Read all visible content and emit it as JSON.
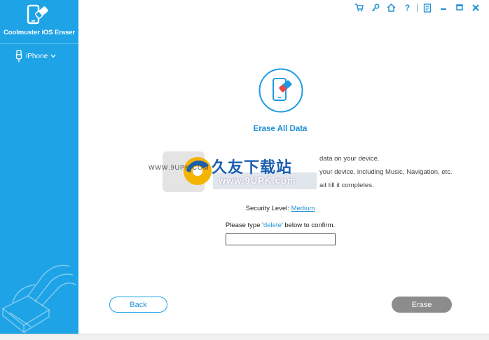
{
  "app": {
    "title": "Coolmuster iOS Eraser",
    "accent_color": "#1ea3e6"
  },
  "sidebar": {
    "device_label": "iPhone",
    "device_icon": "usb-icon",
    "dropdown_icon": "chevron-down-icon"
  },
  "toolbar": {
    "icons": [
      "cart-icon",
      "key-icon",
      "home-icon",
      "help-icon",
      "feedback-icon",
      "minimize-icon",
      "maximize-icon",
      "close-icon"
    ]
  },
  "main": {
    "title": "Erase All Data",
    "desc_lines": [
      "data on your device.",
      "your device, including Music, Navigation, etc.",
      "ait till it completes."
    ],
    "security_prefix": "Security Level:",
    "security_level": "Medium",
    "confirm_prefix": "Please type '",
    "confirm_word": "delete",
    "confirm_suffix": "' below to confirm.",
    "confirm_value": ""
  },
  "watermark": {
    "title": "久友下载站",
    "url": "www.9UPK.com",
    "url_left": "WWW.9UPK.COM"
  },
  "buttons": {
    "back": "Back",
    "erase": "Erase"
  }
}
